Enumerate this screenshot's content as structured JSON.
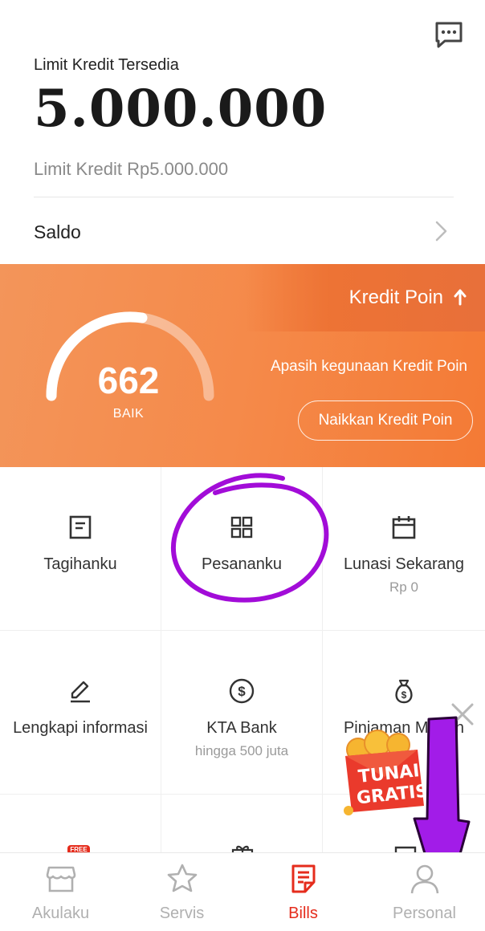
{
  "header": {
    "chat_icon": "chat-bubble-icon",
    "limit_label": "Limit Kredit Tersedia",
    "limit_value": "5.000.000",
    "limit_sub": "Limit Kredit Rp5.000.000",
    "saldo_label": "Saldo"
  },
  "credit": {
    "title": "Kredit Poin",
    "score": "662",
    "level": "BAIK",
    "question": "Apasih kegunaan Kredit Poin",
    "raise_label": "Naikkan Kredit Poin",
    "accent": "#f58a4a"
  },
  "grid": {
    "items": [
      {
        "label": "Tagihanku",
        "sub": "",
        "icon": "bill-document-icon"
      },
      {
        "label": "Pesananku",
        "sub": "",
        "icon": "grid-icon"
      },
      {
        "label": "Lunasi Sekarang",
        "sub": "Rp 0",
        "icon": "calendar-icon"
      },
      {
        "label": "Lengkapi informasi",
        "sub": "",
        "icon": "pencil-icon"
      },
      {
        "label": "KTA Bank",
        "sub": "hingga 500 juta",
        "icon": "dollar-circle-icon"
      },
      {
        "label": "Pinjaman Mudah",
        "sub": "",
        "icon": "money-bag-icon"
      }
    ],
    "free_badge": "FREE"
  },
  "promo": {
    "line1": "TUNAI",
    "line2": "GRATIS"
  },
  "nav": {
    "items": [
      {
        "label": "Akulaku",
        "icon": "store-icon"
      },
      {
        "label": "Servis",
        "icon": "star-icon"
      },
      {
        "label": "Bills",
        "icon": "bills-icon"
      },
      {
        "label": "Personal",
        "icon": "person-icon"
      }
    ],
    "active_color": "#e52c1c",
    "inactive_color": "#b0b0b0"
  }
}
